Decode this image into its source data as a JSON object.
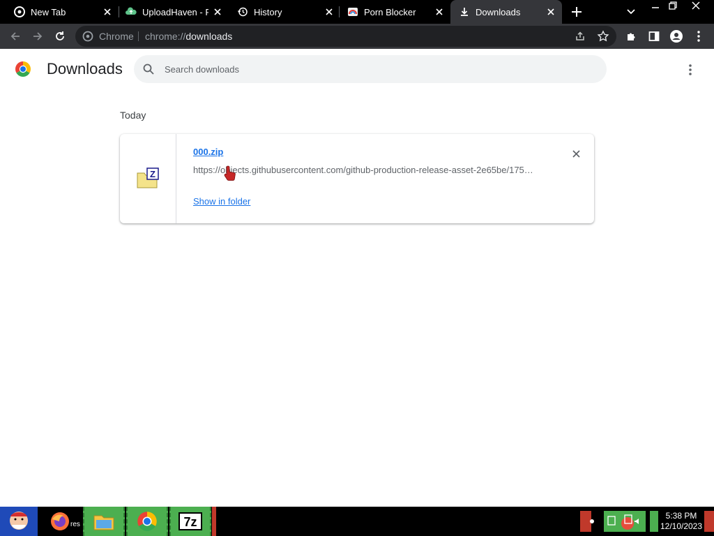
{
  "tabs": [
    {
      "title": "New Tab",
      "icon": "chrome-icon",
      "active": false
    },
    {
      "title": "UploadHaven - Fi",
      "icon": "uploadhaven-icon",
      "active": false
    },
    {
      "title": "History",
      "icon": "history-icon",
      "active": false
    },
    {
      "title": "Porn Blocker",
      "icon": "porn-blocker-icon",
      "active": false
    },
    {
      "title": "Downloads",
      "icon": "download-icon",
      "active": true
    }
  ],
  "omnibox": {
    "site_label": "Chrome",
    "url_scheme": "chrome://",
    "url_host": "downloads"
  },
  "page": {
    "title": "Downloads",
    "search_placeholder": "Search downloads",
    "section_date": "Today"
  },
  "download": {
    "filename": "000.zip",
    "url": "https://objects.githubusercontent.com/github-production-release-asset-2e65be/175…",
    "action": "Show in folder"
  },
  "taskbar": {
    "label": "res",
    "time": "5:38 PM",
    "date": "12/10/2023"
  },
  "colors": {
    "link": "#1a73e8",
    "tabstrip": "#000000",
    "toolbar": "#35363a"
  }
}
